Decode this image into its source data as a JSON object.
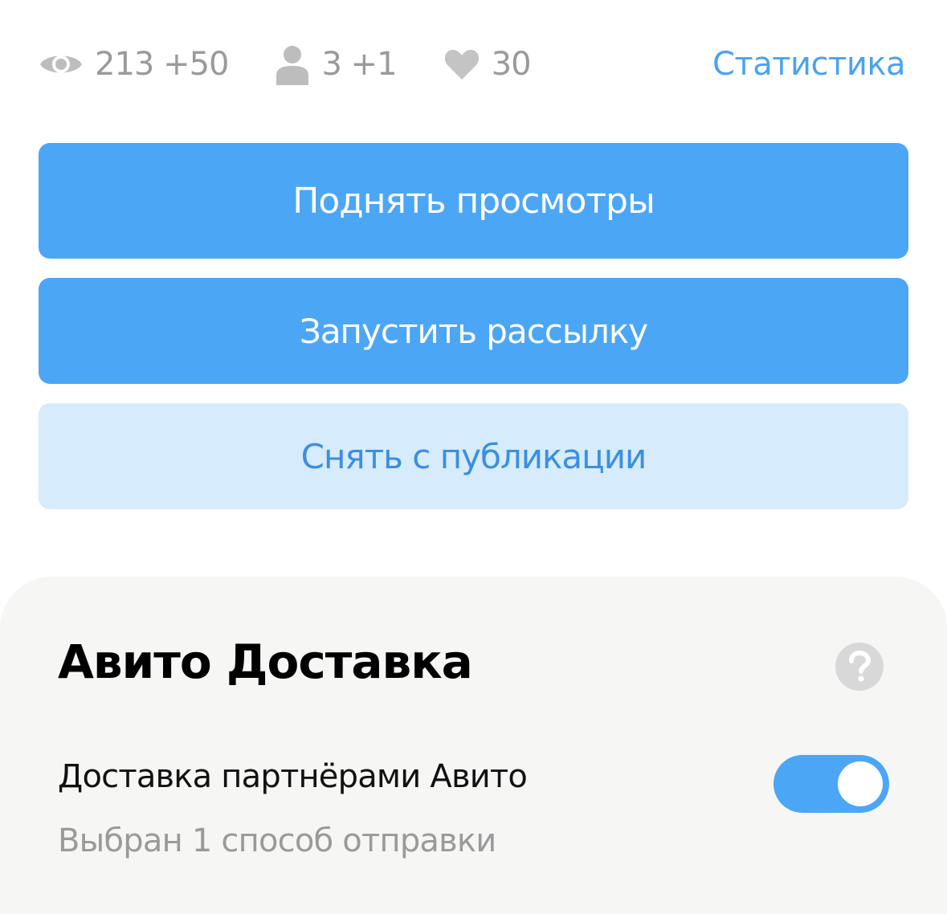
{
  "stats": {
    "views": "213 +50",
    "contacts": "3 +1",
    "favorites": "30",
    "statistics_link": "Статистика"
  },
  "actions": {
    "boost_views": "Поднять просмотры",
    "start_mailing": "Запустить рассылку",
    "unpublish": "Снять с публикации"
  },
  "delivery": {
    "title": "Авито Доставка",
    "option_title": "Доставка партнёрами Авито",
    "option_subtitle": "Выбран 1 способ отправки",
    "toggle_on": true
  },
  "colors": {
    "accent": "#4ca6f6",
    "accent_light": "#d6ebfb",
    "link": "#4aa3f0",
    "muted_text": "#9a9a9a",
    "card_bg": "#f6f6f5"
  }
}
